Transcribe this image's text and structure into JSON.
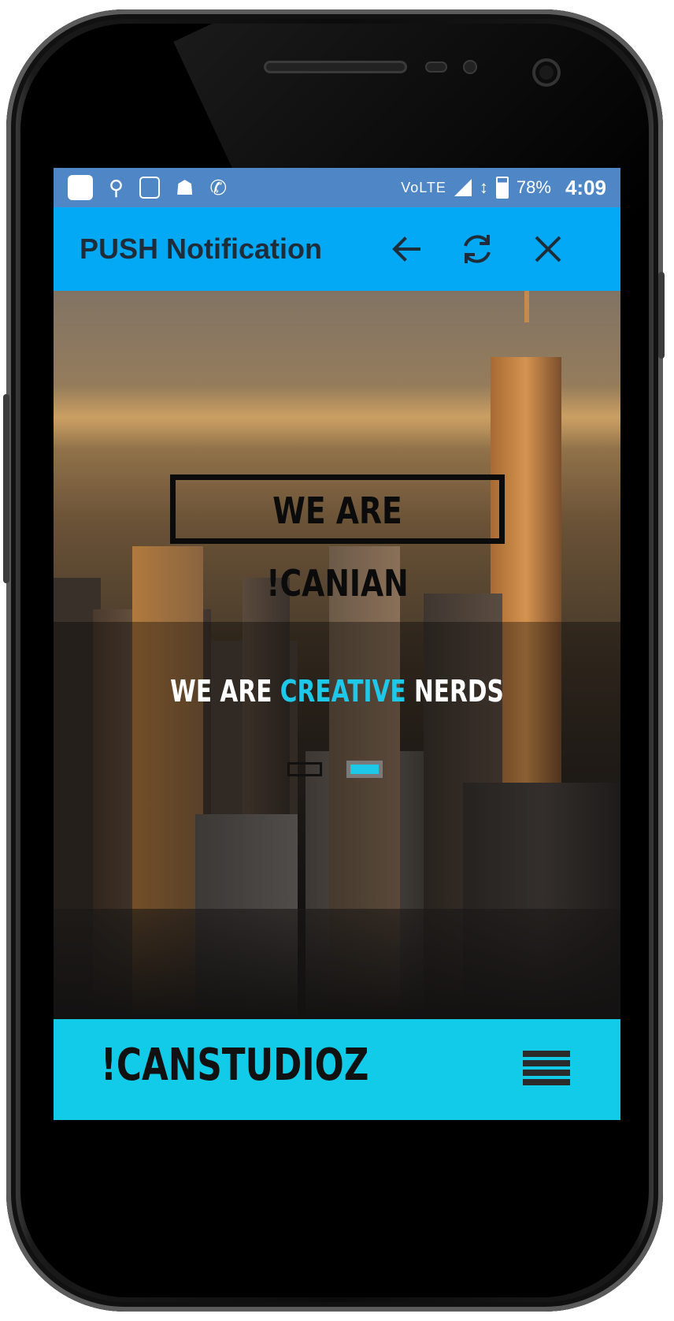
{
  "statusbar": {
    "network": "VoLTE",
    "network_small": "LTE",
    "battery": "78%",
    "time": "4:09"
  },
  "appbar": {
    "title": "PUSH Notification",
    "back_icon": "arrow-left-icon",
    "refresh_icon": "refresh-icon",
    "close_icon": "close-icon"
  },
  "hero": {
    "banner": "WE ARE !CANIAN",
    "tagline_part1": "WE ARE ",
    "tagline_accent": "CREATIVE",
    "tagline_part2": " NERDS",
    "slides": [
      {
        "active": false
      },
      {
        "active": true
      }
    ]
  },
  "footer": {
    "brand": "!CANSTUDIOZ",
    "menu_icon": "hamburger-menu-icon"
  },
  "colors": {
    "statusbar": "#4f86c6",
    "appbar": "#03a9f4",
    "accent": "#1ec8e8",
    "footer": "#12cbe8"
  }
}
